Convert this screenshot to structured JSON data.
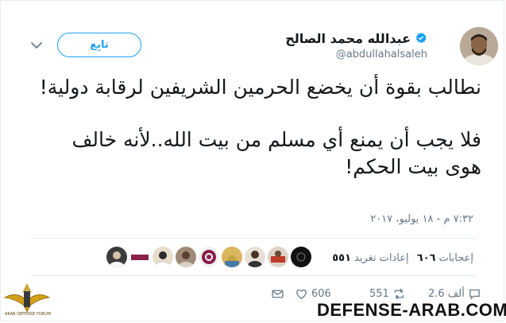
{
  "header": {
    "display_name": "عبدالله محمد الصالح",
    "handle": "@abdullahalsaleh",
    "follow_label": "تابِع"
  },
  "tweet": {
    "paragraphs": [
      "نطالب بقوة أن يخضع الحرمين الشريفين لرقابة دولية!",
      "فلا يجب أن يمنع أي مسلم من بيت الله..لأنه خالف هوى بيت الحكم!"
    ],
    "timestamp": "٧:٣٢ م - ١٨ يوليو، ٢٠١٧"
  },
  "stats": {
    "retweets_count": "٥٥١",
    "retweets_label": "إعادات تغريد",
    "likes_count": "٦٠٦",
    "likes_label": "إعجابات"
  },
  "actions": {
    "replies": "2.6 ألف",
    "retweets": "551",
    "likes": "606"
  },
  "watermark": {
    "site": "DEFENSE-ARAB.COM",
    "logo_caption": "ARAB DEFENSE FORUM"
  },
  "colors": {
    "accent": "#1da1f2",
    "text": "#14171a",
    "muted": "#657786",
    "border": "#e6ecf0"
  }
}
